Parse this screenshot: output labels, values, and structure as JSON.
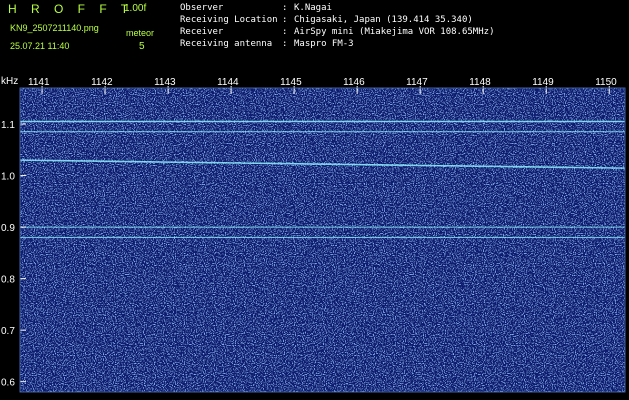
{
  "header": {
    "brand": "H R O F F T",
    "version": "1.00f",
    "filename": "KN9_2507211140.png",
    "meteors_label": "meteor",
    "timestamp": "25.07.21 11:40",
    "meteor_count": "5",
    "info": [
      {
        "key": "Observer",
        "value": "K.Nagai"
      },
      {
        "key": "Receiving Location",
        "value": "Chigasaki, Japan (139.414 35.340)"
      },
      {
        "key": "Receiver",
        "value": "AirSpy mini (Miakejima VOR 108.65MHz)"
      },
      {
        "key": "Receiving antenna",
        "value": "Maspro FM-3"
      }
    ],
    "separator": ":"
  },
  "chart_data": {
    "type": "heatmap",
    "ylabel": "kHz",
    "x_ticks": [
      "1141",
      "1142",
      "1143",
      "1144",
      "1145",
      "1146",
      "1147",
      "1148",
      "1149",
      "1150"
    ],
    "y_ticks": [
      "1.1",
      "1.0",
      "0.9",
      "0.8",
      "0.7",
      "0.6"
    ],
    "ylim": [
      0.58,
      1.17
    ],
    "xlim": [
      1140.65,
      1150.25
    ],
    "signal_lines_khz": [
      1.105,
      1.03,
      1.085,
      0.9,
      0.88
    ],
    "background_color": "#0a1a6e",
    "noise_color": "#3a6fe0",
    "signal_color": "#8ff0ff"
  }
}
